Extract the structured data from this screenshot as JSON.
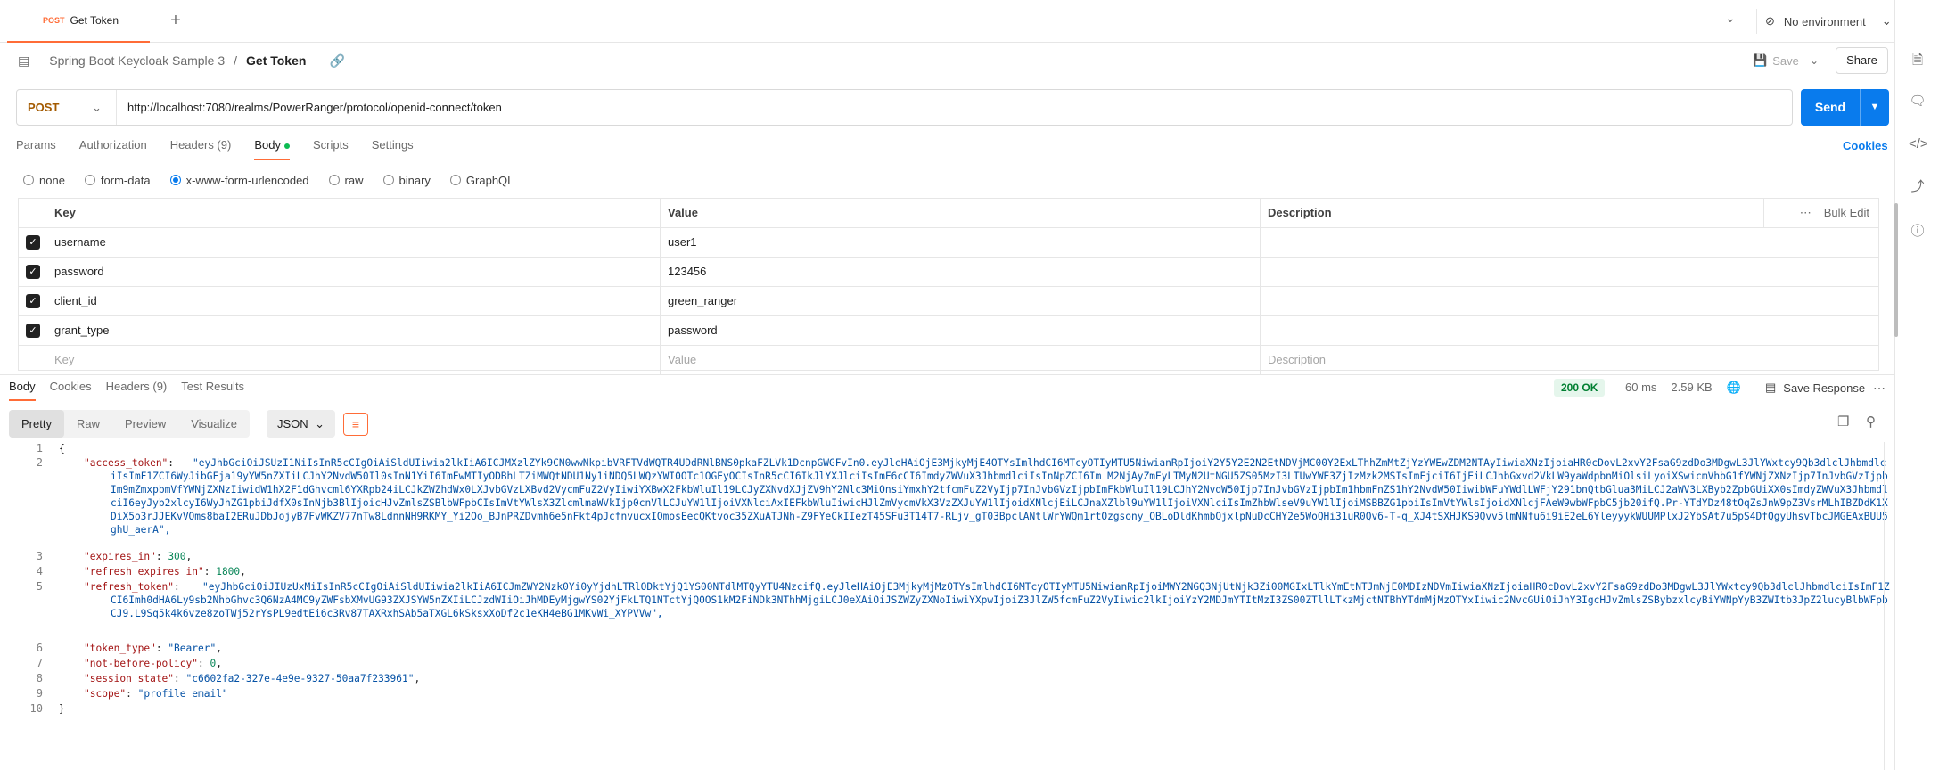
{
  "tab": {
    "method": "POST",
    "title": "Get Token",
    "new_tab": "+"
  },
  "environment": {
    "label": "No environment"
  },
  "breadcrumb": {
    "collection": "Spring Boot Keycloak Sample 3",
    "separator": "/",
    "request": "Get Token"
  },
  "actions": {
    "save": "Save",
    "share": "Share"
  },
  "request": {
    "method": "POST",
    "url": "http://localhost:7080/realms/PowerRanger/protocol/openid-connect/token",
    "send": "Send"
  },
  "request_tabs": [
    "Params",
    "Authorization",
    "Headers (9)",
    "Body",
    "Scripts",
    "Settings"
  ],
  "cookies_link": "Cookies",
  "body_types": [
    "none",
    "form-data",
    "x-www-form-urlencoded",
    "raw",
    "binary",
    "GraphQL"
  ],
  "params_table": {
    "headers": {
      "key": "Key",
      "value": "Value",
      "description": "Description",
      "bulk_edit": "Bulk Edit"
    },
    "rows": [
      {
        "key": "username",
        "value": "user1",
        "description": ""
      },
      {
        "key": "password",
        "value": "123456",
        "description": ""
      },
      {
        "key": "client_id",
        "value": "green_ranger",
        "description": ""
      },
      {
        "key": "grant_type",
        "value": "password",
        "description": ""
      }
    ],
    "placeholder": {
      "key": "Key",
      "value": "Value",
      "description": "Description"
    }
  },
  "response": {
    "tabs": [
      "Body",
      "Cookies",
      "Headers (9)",
      "Test Results"
    ],
    "status": "200 OK",
    "time": "60 ms",
    "size": "2.59 KB",
    "save_response": "Save Response",
    "views": [
      "Pretty",
      "Raw",
      "Preview",
      "Visualize"
    ],
    "format": "JSON"
  },
  "code": {
    "line_numbers": [
      "1",
      "2",
      "3",
      "4",
      "5",
      "6",
      "7",
      "8",
      "9",
      "10"
    ],
    "open_brace": "{",
    "close_brace": "}",
    "access_token_key": "\"access_token\"",
    "access_token_value": "\"eyJhbGciOiJSUzI1NiIsInR5cCIgOiAiSldUIiwia2lkIiA6ICJMXzlZYk9CN0wwNkpibVRFTVdWQTR4UDdRNlBNS0pkaFZLVk1DcnpGWGFvIn0.eyJleHAiOjE3MjkyMjE4OTYsImlhdCI6MTcyOTIyMTU5NiwianRpIjoiY2Y5Y2E2N2EtNDVjMC00Y2ExLThhZmMtZjYzYWEwZDM2NTAyIiwiaXNzIjoiaHR0cDovL2xvY2FsaG9zdDo3MDgwL3JlYWxtcy9Qb3dlclJhbmdlciIsImF1ZCI6WyJibGFja19yYW5nZXIiLCJhY2NvdW50Il0sInN1YiI6ImEwMTIyODBhLTZiMWQtNDU1Ny1iNDQ5LWQzYWI0OTc1OGEyOCIsInR5cCI6IkJlYXJlciIsImF6cCI6ImdyZWVuX3JhbmdlciIsInNpZCI6Im M2NjAyZmEyLTMyN2UtNGU5ZS05MzI3LTUwYWE3ZjIzMzk2MSIsImFjciI6IjEiLCJhbGxvd2VkLW9yaWdpbnMiOlsiLyoiXSwicmVhbG1fYWNjZXNzIjp7InJvbGVzIjpbIm9mZmxpbmVfYWNjZXNzIiwidW1hX2F1dGhvcml6YXRpb24iLCJkZWZhdWx0LXJvbGVzLXBvd2VycmFuZ2VyIiwiYXBwX2FkbWluIl19LCJyZXNvdXJjZV9hY2Nlc3MiOnsiYmxhY2tfcmFuZ2VyIjp7InJvbGVzIjpbImFkbWluIl19LCJhY2NvdW50Ijp7InJvbGVzIjpbIm1hbmFnZS1hY2NvdW50IiwibWFuYWdlLWFjY291bnQtbGlua3MiLCJ2aWV3LXByb2ZpbGUiXX0sImdyZWVuX3JhbmdlciI6eyJyb2xlcyI6WyJhZG1pbiJdfX0sInNjb3BlIjoicHJvZmlsZSBlbWFpbCIsImVtYWlsX3ZlcmlmaWVkIjp0cnVlLCJuYW1lIjoiVXNlciAxIEFkbWluIiwicHJlZmVycmVkX3VzZXJuYW1lIjoidXNlcjEiLCJnaXZlbl9uYW1lIjoiVXNlciIsImZhbWlseV9uYW1lIjoiMSBBZG1pbiIsImVtYWlsIjoidXNlcjFAeW9wbWFpbC5jb20ifQ.Pr-YTdYDz48tOqZsJnW9pZ3VsrMLhIBZDdK1XDiX5o3rJJEKvVOms8baI2ERuJDbJojyB7FvWKZV77nTw8LdnnNH9RKMY_Yi2Oo_BJnPRZDvmh6e5nFkt4pJcfnvucxIOmosEecQKtvoc35ZXuATJNh-Z9FYeCkIIezT45SFu3T14T7-RLjv_gT03BpclANtlWrYWQm1rtOzgsony_OBLoDldKhmbOjxlpNuDcCHY2e5WoQHi31uR0Qv6-T-q_XJ4tSXHJKS9Qvv5lmNNfu6i9iE2eL6YleyyykWUUMPlxJ2YbSAt7u5pS4DfQgyUhsvTbcJMGEAxBUU5ghU_aerA\",",
    "expires_in_key": "\"expires_in\"",
    "expires_in_value": "300",
    "refresh_expires_in_key": "\"refresh_expires_in\"",
    "refresh_expires_in_value": "1800",
    "refresh_token_key": "\"refresh_token\"",
    "refresh_token_value": "\"eyJhbGciOiJIUzUxMiIsInR5cCIgOiAiSldUIiwia2lkIiA6ICJmZWY2Nzk0Yi0yYjdhLTRlODktYjQ1YS00NTdlMTQyYTU4NzcifQ.eyJleHAiOjE3MjkyMjMzOTYsImlhdCI6MTcyOTIyMTU5NiwianRpIjoiMWY2NGQ3NjUtNjk3Zi00MGIxLTlkYmEtNTJmNjE0MDIzNDVmIiwiaXNzIjoiaHR0cDovL2xvY2FsaG9zdDo3MDgwL3JlYWxtcy9Qb3dlclJhbmdlciIsImF1ZCI6Imh0dHA6Ly9sb2NhbGhvc3Q6NzA4MC9yZWFsbXMvUG93ZXJSYW5nZXIiLCJzdWIiOiJhMDEyMjgwYS02YjFkLTQ1NTctYjQ0OS1kM2FiNDk3NThhMjgiLCJ0eXAiOiJSZWZyZXNoIiwiYXpwIjoiZ3JlZW5fcmFuZ2VyIiwic2lkIjoiYzY2MDJmYTItMzI3ZS00ZTllLTkzMjctNTBhYTdmMjMzOTYxIiwic2NvcGUiOiJhY3IgcHJvZmlsZSBybzxlcyBiYWNpYyB3ZWItb3JpZ2lucyBlbWFpbCJ9.L9Sq5k4k6vze8zoTWj52rYsPL9edtEi6c3Rv87TAXRxhSAb5aTXGL6kSksxXoDf2c1eKH4eBG1MKvWi_XYPVVw\",",
    "token_type_key": "\"token_type\"",
    "token_type_value": "\"Bearer\"",
    "not_before_policy_key": "\"not-before-policy\"",
    "not_before_policy_value": "0",
    "session_state_key": "\"session_state\"",
    "session_state_value": "\"c6602fa2-327e-4e9e-9327-50aa7f233961\"",
    "scope_key": "\"scope\"",
    "scope_value": "\"profile email\""
  },
  "colors": {
    "accent": "#ff6c37",
    "send": "#097bed",
    "status_ok_bg": "#e5f6ec",
    "status_ok_text": "#007f31"
  }
}
